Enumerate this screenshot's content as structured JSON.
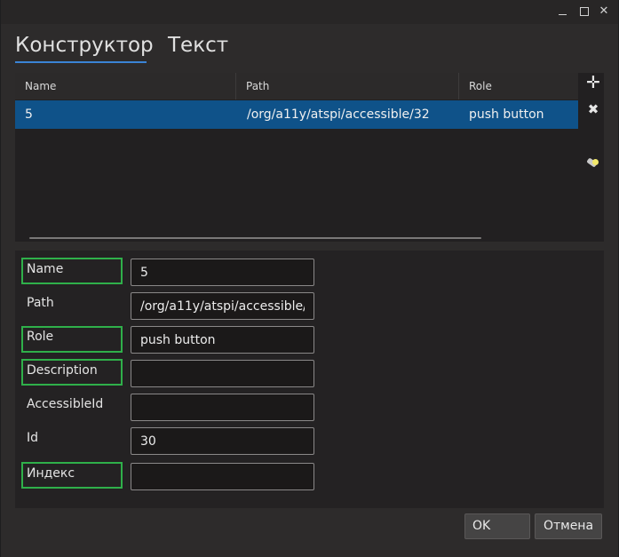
{
  "window": {
    "controls": {
      "minimize": "minimize-icon",
      "maximize": "maximize-icon",
      "close": "close-icon"
    }
  },
  "tabs": [
    {
      "label": "Конструктор",
      "active": true
    },
    {
      "label": "Текст",
      "active": false
    }
  ],
  "table": {
    "columns": [
      "Name",
      "Path",
      "Role"
    ],
    "rows": [
      {
        "name": "5",
        "path": "/org/a11y/atspi/accessible/32",
        "role": "push button",
        "selected": true
      }
    ]
  },
  "side_icons": [
    "add-icon",
    "remove-icon",
    "highlight-icon"
  ],
  "form": {
    "fields": [
      {
        "label": "Name",
        "value": "5",
        "highlighted": true
      },
      {
        "label": "Path",
        "value": "/org/a11y/atspi/accessible/32",
        "highlighted": false
      },
      {
        "label": "Role",
        "value": "push button",
        "highlighted": true
      },
      {
        "label": "Description",
        "value": "",
        "highlighted": true
      },
      {
        "label": "AccessibleId",
        "value": "",
        "highlighted": false
      },
      {
        "label": "Id",
        "value": "30",
        "highlighted": false
      },
      {
        "label": "Индекс",
        "value": "",
        "highlighted": true
      }
    ]
  },
  "buttons": {
    "ok": "OK",
    "cancel": "Отмена"
  },
  "colors": {
    "selection": "#0f5289",
    "tab_underline": "#3a84d6",
    "highlight_box": "#2fb04a"
  }
}
